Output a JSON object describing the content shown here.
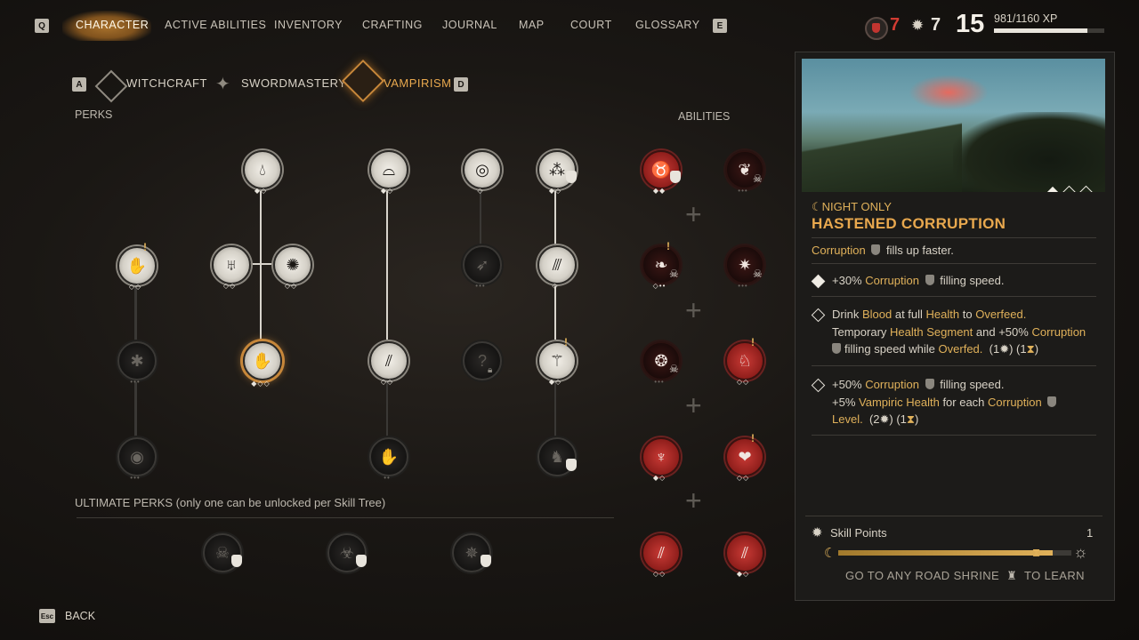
{
  "nav": {
    "key_left": "Q",
    "key_right": "E",
    "tabs": [
      "CHARACTER",
      "ACTIVE ABILITIES",
      "INVENTORY",
      "CRAFTING",
      "JOURNAL",
      "MAP",
      "COURT",
      "GLOSSARY"
    ]
  },
  "status": {
    "stat_a": "7",
    "stat_b": "7",
    "level": "15",
    "xp_text": "981/1160 XP",
    "xp_progress": 0.846
  },
  "trees": {
    "key_left": "A",
    "key_right": "D",
    "tabs": [
      "WITCHCRAFT",
      "SWORDMASTERY",
      "VAMPIRISM"
    ],
    "active": "VAMPIRISM"
  },
  "sections": {
    "perks": "PERKS",
    "abilities": "ABILITIES",
    "ultimate": "ULTIMATE PERKS (only one can be unlocked per Skill Tree)"
  },
  "detail": {
    "night_tag": "NIGHT ONLY",
    "title": "HASTENED CORRUPTION",
    "summary_word": "Corruption",
    "summary_rest": "fills up faster.",
    "tier1_a": "+30%",
    "tier1_b": "Corruption",
    "tier1_c": "filling speed.",
    "tier2_l1_a": "Drink",
    "tier2_l1_b": "Blood",
    "tier2_l1_c": "at full",
    "tier2_l1_d": "Health",
    "tier2_l1_e": "to",
    "tier2_l1_f": "Overfeed.",
    "tier2_l2_a": "Temporary",
    "tier2_l2_b": "Health Segment",
    "tier2_l2_c": "and +50%",
    "tier2_l2_d": "Corruption",
    "tier2_l3_a": "filling speed while",
    "tier2_l3_b": "Overfed.",
    "tier2_l3_cost": "(1",
    "tier2_l3_cost2": ") (1",
    "tier2_l3_end": ")",
    "tier3_l1_a": "+50%",
    "tier3_l1_b": "Corruption",
    "tier3_l1_c": "filling speed.",
    "tier3_l2_a": "+5%",
    "tier3_l2_b": "Vampiric Health",
    "tier3_l2_c": "for each",
    "tier3_l2_d": "Corruption",
    "tier3_l3_a": "Level.",
    "tier3_l3_cost": "(2",
    "tier3_l3_cost2": ") (1",
    "tier3_l3_end": ")",
    "skill_points_label": "Skill Points",
    "skill_points_value": "1",
    "skill_progress": 0.92,
    "shrine_a": "GO TO ANY ROAD SHRINE",
    "shrine_b": "TO LEARN"
  },
  "footer": {
    "key": "Esc",
    "back": "BACK"
  },
  "colors": {
    "accent_gold": "#e0b15a",
    "brush": "#b77b2f",
    "red": "#c83a35",
    "stat_red": "#d23b32"
  },
  "icons": [
    "moon-icon",
    "skull-icon",
    "hourglass-icon",
    "gear-icon",
    "sun-icon",
    "shield-icon",
    "lock-icon",
    "warning-icon"
  ]
}
